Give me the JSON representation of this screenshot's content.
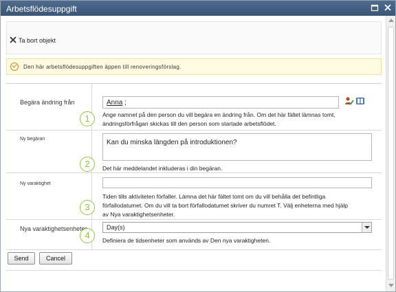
{
  "window": {
    "title": "Arbetsflödesuppgift"
  },
  "ribbon": {
    "delete_label": "Ta bort objekt"
  },
  "info_bar": {
    "message": "Den här arbetsflödesuppgiften äppen till renoveringsförslag."
  },
  "form": {
    "rows": [
      {
        "number": "1",
        "label": "Begära ändring från",
        "person_name": "Anna",
        "person_suffix": " ;",
        "description_1": "Ange namnet på den person du vill begära en ändring från. Om det här fältet lämnas tomt,",
        "description_2": "ändringsförfrågan skickas till den person som startade arbetsflödet."
      },
      {
        "number": "2",
        "label": "Ny begäran",
        "value": "Kan du minska längden på introduktionen?",
        "description": "Det här meddelandet inkluderas i din begäran."
      },
      {
        "number": "3",
        "label": "Ny varaktighet",
        "value": "",
        "description_1": "Tiden tills aktiviteten förfaller. Lämna det här fältet tomt om du vill behålla det befintliga",
        "description_2": "förfallodatumet. Om du vill ta bort förfallodatumet skriver du numret T. Välj enheterna med hjälp",
        "description_3": "av Nya varaktighetsenheter."
      },
      {
        "number": "4",
        "label": "Nya varaktighetsenheter",
        "selected_value": "Day(s)",
        "description": "Definiera de tidsenheter som används av Den nya varaktigheten."
      }
    ]
  },
  "buttons": {
    "send": "Send",
    "cancel": "Cancel"
  },
  "colors": {
    "title_bar": "#3f5b7d",
    "step_number": "#8cc63e",
    "info_bar_bg": "#fffbe0"
  },
  "icons": {
    "delete": "x-icon",
    "info": "checkmark-circle-icon",
    "check_names": "person-check-icon",
    "browse": "address-book-icon"
  }
}
